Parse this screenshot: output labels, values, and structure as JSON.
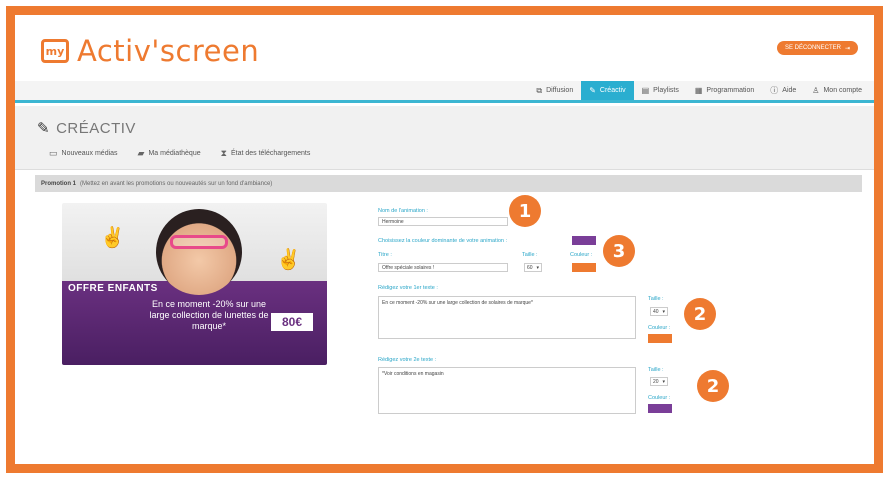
{
  "brand": {
    "name": "Activ'screen",
    "mark": "my"
  },
  "header": {
    "logout_label": "SE DÉCONNECTER"
  },
  "nav": {
    "items": [
      {
        "label": "Diffusion",
        "icon": "⧉"
      },
      {
        "label": "Créactiv",
        "icon": "✎"
      },
      {
        "label": "Playlists",
        "icon": "▤"
      },
      {
        "label": "Programmation",
        "icon": "▦"
      },
      {
        "label": "Aide",
        "icon": "ⓘ"
      },
      {
        "label": "Mon compte",
        "icon": "♙"
      }
    ],
    "active_index": 1
  },
  "section": {
    "title": "CRÉACTIV",
    "subnav": [
      {
        "label": "Nouveaux médias",
        "icon": "▭"
      },
      {
        "label": "Ma médiathèque",
        "icon": "▰"
      },
      {
        "label": "État des téléchargements",
        "icon": "⧗"
      }
    ]
  },
  "promo": {
    "title": "Promotion 1",
    "description": "(Mettez en avant les promotions ou nouveautés sur un fond d'ambiance)"
  },
  "preview": {
    "offer_title": "OFFRE ENFANTS",
    "offer_text": "En ce moment -20% sur une large collection de lunettes de marque*",
    "price": "80€"
  },
  "form": {
    "name_label": "Nom de l'animation :",
    "name_value": "Hermoine",
    "color_choice_label": "Choisissez la couleur dominante de votre animation :",
    "title_label": "Titre :",
    "title_value": "Offre spéciale solaires !",
    "size_label": "Taille :",
    "color_label": "Couleur :",
    "title_size": "60",
    "text1_label": "Rédigez votre 1er texte :",
    "text1_value": "En ce moment -20% sur une large collection de solaires de marque*",
    "text1_size": "40",
    "text2_label": "Rédigez votre 2e texte :",
    "text2_value": "*Voir conditions en magasin",
    "text2_size": "20"
  },
  "badges": [
    "1",
    "3",
    "2",
    "2"
  ],
  "colors": {
    "accent": "#ee7a30",
    "blue": "#2aaed0",
    "purple": "#7a3e98",
    "orange_swatch": "#ee7a30"
  }
}
